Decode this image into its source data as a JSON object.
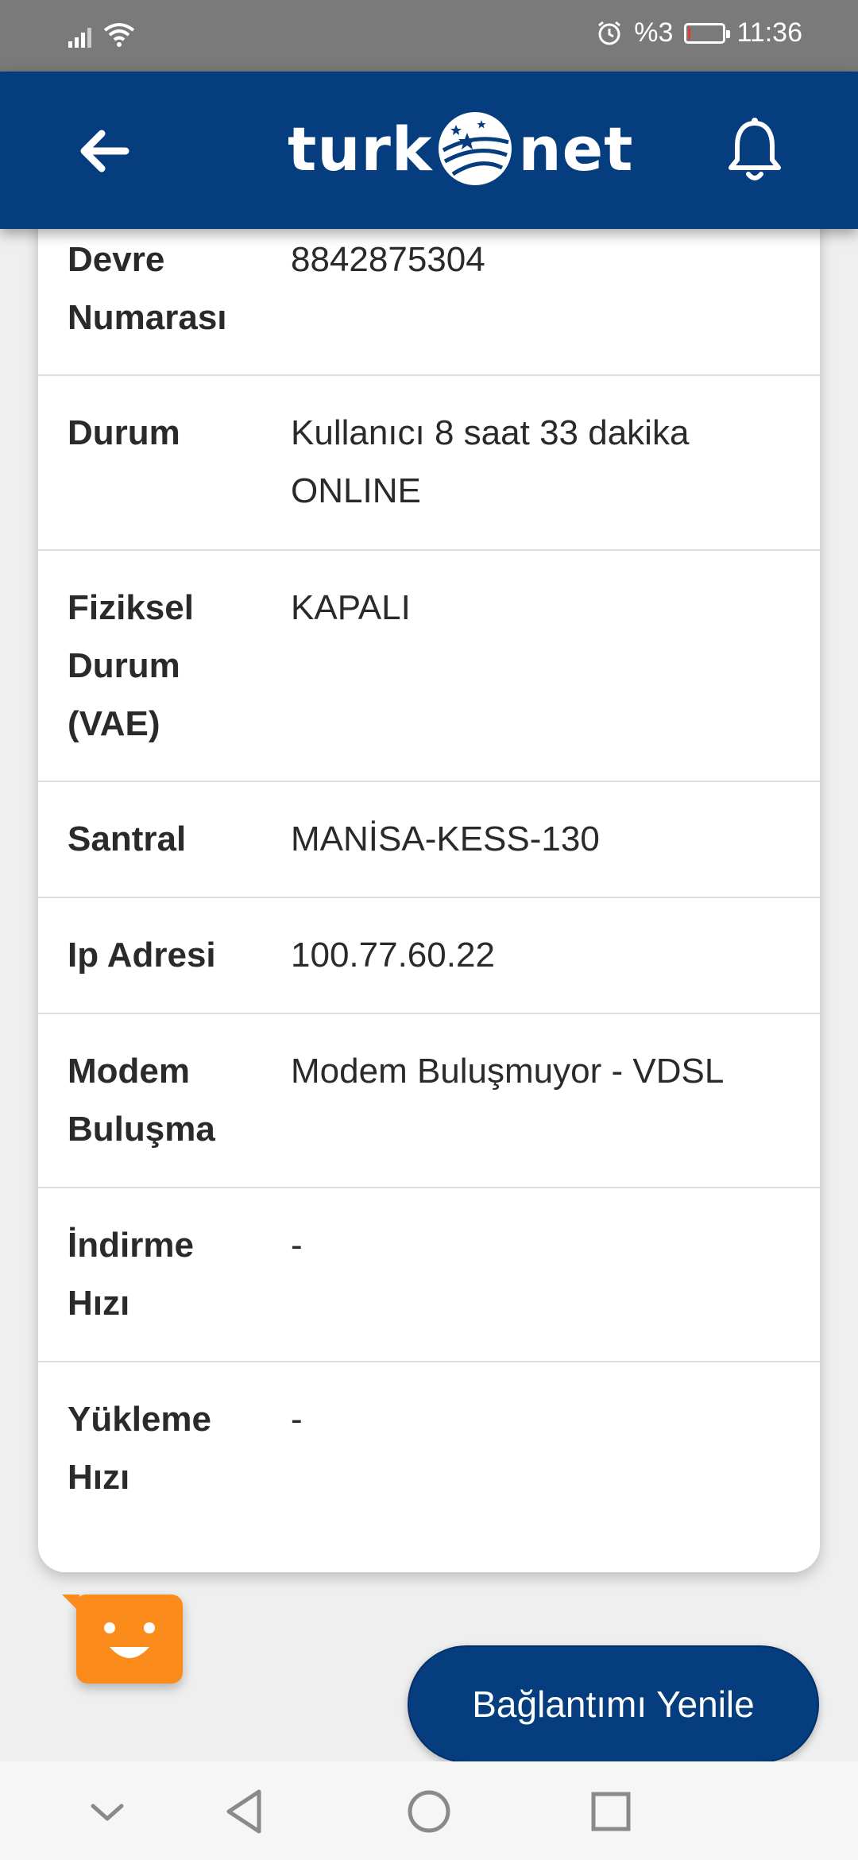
{
  "status_bar": {
    "battery_text": "%3",
    "battery_level": 0.03,
    "time": "11:36",
    "icons": [
      "signal-icon",
      "wifi-icon",
      "alarm-icon",
      "battery-icon"
    ]
  },
  "header": {
    "logo_left": "turk",
    "logo_right": "net",
    "back_icon": "arrow-left-icon",
    "bell_icon": "bell-icon"
  },
  "details": [
    {
      "label": "Devre\nNumarası",
      "value": "8842875304"
    },
    {
      "label": "Durum",
      "value": "Kullanıcı 8 saat 33 dakika ONLINE"
    },
    {
      "label": "Fiziksel\nDurum\n(VAE)",
      "value": "KAPALI"
    },
    {
      "label": "Santral",
      "value": "MANİSA-KESS-130"
    },
    {
      "label": "Ip Adresi",
      "value": "100.77.60.22"
    },
    {
      "label": "Modem\nBuluşma",
      "value": "Modem Buluşmuyor - VDSL"
    },
    {
      "label": "İndirme\nHızı",
      "value": "-"
    },
    {
      "label": "Yükleme\nHızı",
      "value": "-"
    }
  ],
  "actions": {
    "reconnect_label": "Bağlantımı Yenile"
  },
  "colors": {
    "brand_blue": "#053d7e",
    "chatbot_orange": "#fb8c1b",
    "status_bar": "#7a7a7a"
  },
  "nav_bar": {
    "icons": [
      "chevron-down-icon",
      "back-triangle-icon",
      "home-circle-icon",
      "recents-square-icon"
    ]
  }
}
